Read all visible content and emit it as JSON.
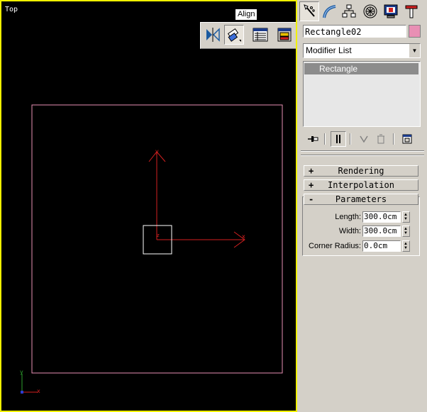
{
  "viewport": {
    "label": "Top",
    "border_color": "#f0f000"
  },
  "tooltip": {
    "text": "Align"
  },
  "toolbar": {
    "buttons": [
      {
        "icon": "mirror-icon"
      },
      {
        "icon": "align-icon",
        "active": true
      },
      {
        "icon": "layer-manager-icon"
      },
      {
        "icon": "curve-editor-icon"
      }
    ]
  },
  "command_panel": {
    "tabs": [
      {
        "icon": "create-tab-icon",
        "active": true
      },
      {
        "icon": "modify-tab-icon"
      },
      {
        "icon": "hierarchy-tab-icon"
      },
      {
        "icon": "motion-tab-icon"
      },
      {
        "icon": "display-tab-icon"
      },
      {
        "icon": "utilities-tab-icon"
      }
    ],
    "object_name": "Rectangle02",
    "object_color": "#e88fb4",
    "modifier_list": "Modifier List",
    "stack_items": [
      "Rectangle"
    ],
    "stack_tools": [
      "pin-stack-icon",
      "show-end-result-icon",
      "make-unique-icon",
      "remove-modifier-icon",
      "configure-sets-icon"
    ]
  },
  "rollouts": {
    "rendering": {
      "sign": "+",
      "title": "Rendering"
    },
    "interpolation": {
      "sign": "+",
      "title": "Interpolation"
    },
    "parameters": {
      "sign": "-",
      "title": "Parameters"
    }
  },
  "parameters": {
    "length": {
      "label": "Length:",
      "value": "300.0cm"
    },
    "width": {
      "label": "Width:",
      "value": "300.0cm"
    },
    "corner_radius": {
      "label": "Corner Radius:",
      "value": "0.0cm"
    }
  },
  "colors": {
    "shape": "#e88fb4",
    "gizmo": "#d42020",
    "selection_box": "#ffffff",
    "axis_y": "#2ea02e",
    "axis_x": "#d42020",
    "axis_z": "#2c3cd0"
  },
  "gizmo": {
    "x_label": "x",
    "y_label": "y",
    "z_label": "z"
  },
  "axis_tripod": {
    "x_label": "x",
    "y_label": "y"
  }
}
